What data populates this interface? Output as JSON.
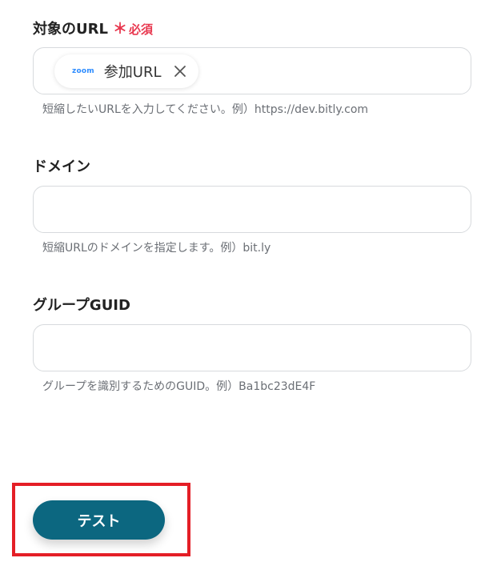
{
  "fields": [
    {
      "label": "対象のURL",
      "required_mark": "＊",
      "required_text": "必須",
      "value_chip": {
        "logo": "zoom",
        "label": "参加URL"
      },
      "help": "短縮したいURLを入力してください。例）https://dev.bitly.com"
    },
    {
      "label": "ドメイン",
      "value": "",
      "help": "短縮URLのドメインを指定します。例）bit.ly"
    },
    {
      "label": "グループGUID",
      "value": "",
      "help": "グループを識別するためのGUID。例）Ba1bc23dE4F"
    }
  ],
  "test_button": {
    "label": "テスト"
  },
  "colors": {
    "required": "#e8384f",
    "button": "#0c6780",
    "highlight": "#e41e26",
    "zoom_logo": "#2d8cff"
  }
}
